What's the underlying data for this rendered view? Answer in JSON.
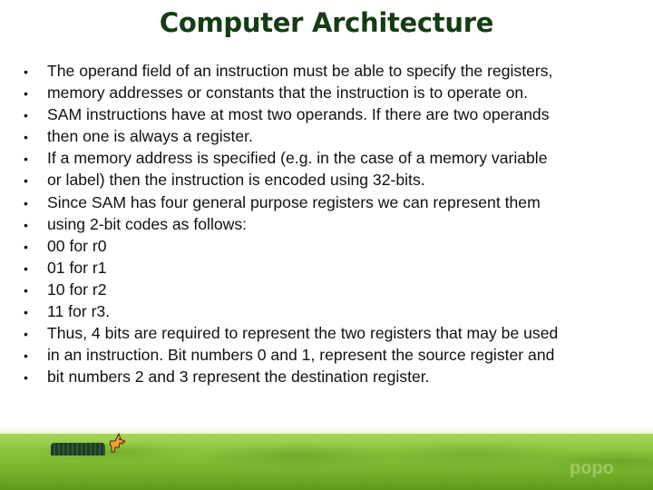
{
  "slide": {
    "title": "Computer Architecture",
    "bullet_glyph": "•",
    "bullets": [
      "The operand field of an instruction must be able to specify the registers,",
      "memory addresses or constants that the instruction is to operate on.",
      "SAM instructions have at most two operands. If there are two operands",
      "then one is always a register.",
      "If a memory address is specified (e.g. in the case of a memory variable",
      "or label) then the instruction is encoded using 32-bits.",
      "Since SAM has four general purpose registers we can represent them",
      "using 2-bit codes as follows:",
      "00 for r0",
      "01 for r1",
      "10 for r2",
      "11 for r3.",
      "Thus, 4 bits are required to represent the two registers that may be used",
      "in an instruction. Bit numbers 0 and 1, represent the source register and",
      "bit numbers 2 and 3 represent the destination register."
    ],
    "watermark": "popo"
  },
  "colors": {
    "title": "#143d14",
    "text": "#111111",
    "grass": "#8cc43c"
  }
}
